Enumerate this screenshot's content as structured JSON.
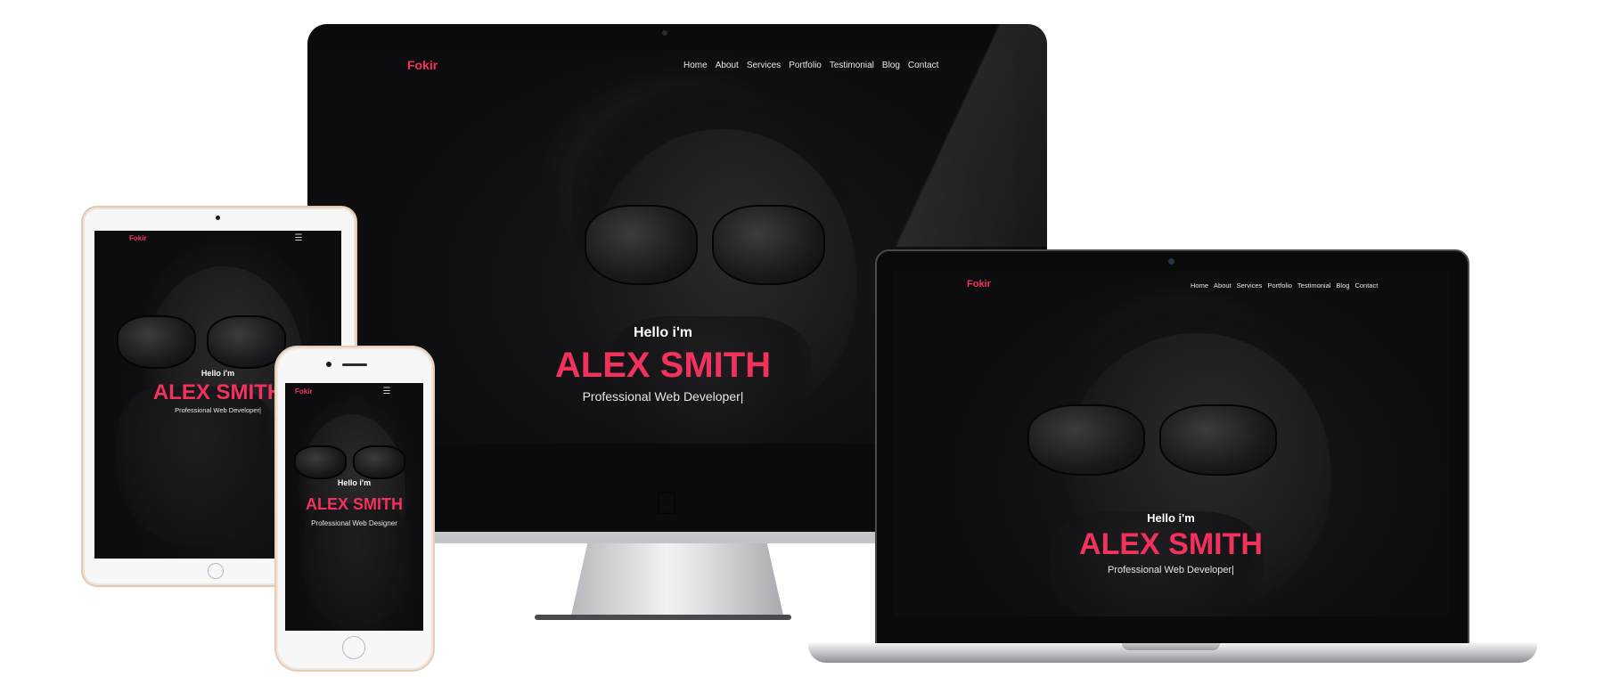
{
  "brand_color": "#f2315d",
  "imac": {
    "brand": "Fokir",
    "nav": [
      "Home",
      "About",
      "Services",
      "Portfolio",
      "Testimonial",
      "Blog",
      "Contact"
    ],
    "hello": "Hello i'm",
    "name": "ALEX SMITH",
    "role": "Professional Web Developer|"
  },
  "laptop": {
    "brand": "Fokir",
    "nav": [
      "Home",
      "About",
      "Services",
      "Portfolio",
      "Testimonial",
      "Blog",
      "Contact"
    ],
    "hello": "Hello i'm",
    "name": "ALEX SMITH",
    "role": "Professional Web Developer|"
  },
  "tablet": {
    "brand": "Fokir",
    "menu_icon": "hamburger-icon",
    "hello": "Hello i'm",
    "name": "ALEX SMITH",
    "role": "Professional Web Developer|"
  },
  "phone": {
    "brand": "Fokir",
    "menu_icon": "hamburger-icon",
    "hello": "Hello i'm",
    "name": "ALEX SMITH",
    "role": "Professional Web Designer"
  }
}
